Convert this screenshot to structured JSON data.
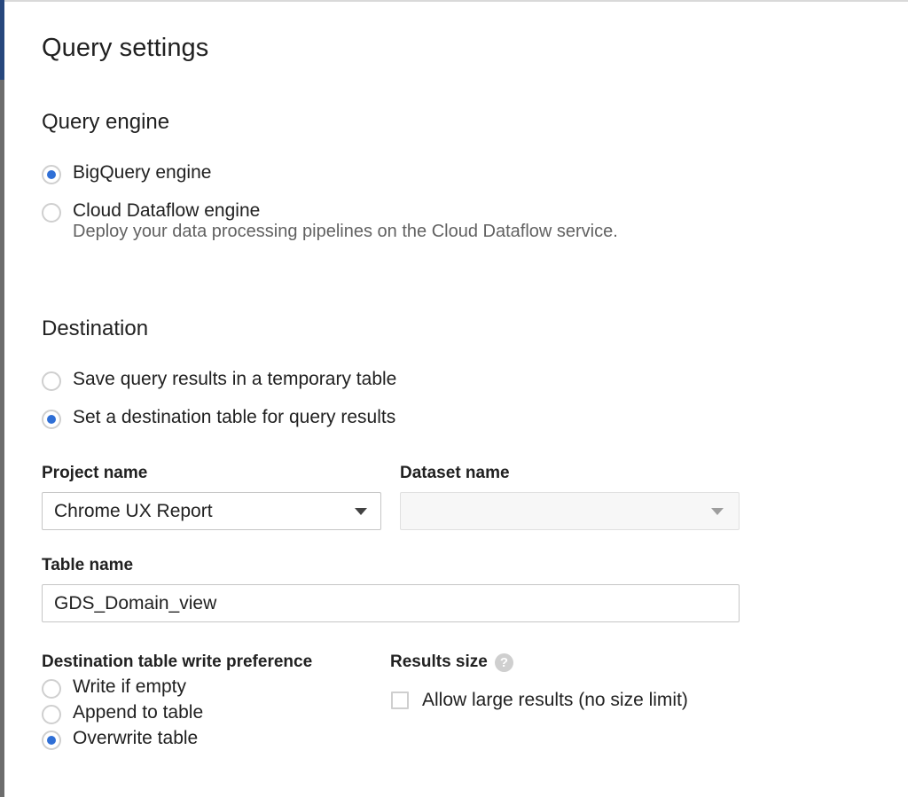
{
  "dialog": {
    "title": "Query settings"
  },
  "query_engine": {
    "title": "Query engine",
    "options": [
      {
        "label": "BigQuery engine",
        "selected": true
      },
      {
        "label": "Cloud Dataflow engine",
        "description": "Deploy your data processing pipelines on the Cloud Dataflow service.",
        "selected": false
      }
    ]
  },
  "destination": {
    "title": "Destination",
    "options": [
      {
        "label": "Save query results in a temporary table",
        "selected": false
      },
      {
        "label": "Set a destination table for query results",
        "selected": true
      }
    ],
    "project": {
      "label": "Project name",
      "value": "Chrome UX Report"
    },
    "dataset": {
      "label": "Dataset name",
      "value": ""
    },
    "table": {
      "label": "Table name",
      "value": "GDS_Domain_view"
    },
    "write_preference": {
      "label": "Destination table write preference",
      "options": [
        {
          "label": "Write if empty",
          "selected": false
        },
        {
          "label": "Append to table",
          "selected": false
        },
        {
          "label": "Overwrite table",
          "selected": true
        }
      ]
    },
    "results_size": {
      "label": "Results size",
      "help_icon": "question-mark-icon",
      "help_glyph": "?",
      "checkbox_label": "Allow large results (no size limit)",
      "checked": false
    }
  },
  "colors": {
    "accent": "#2f6fd6",
    "control_border": "#cfcfcf",
    "text_primary": "#212121",
    "text_secondary": "#616161"
  }
}
